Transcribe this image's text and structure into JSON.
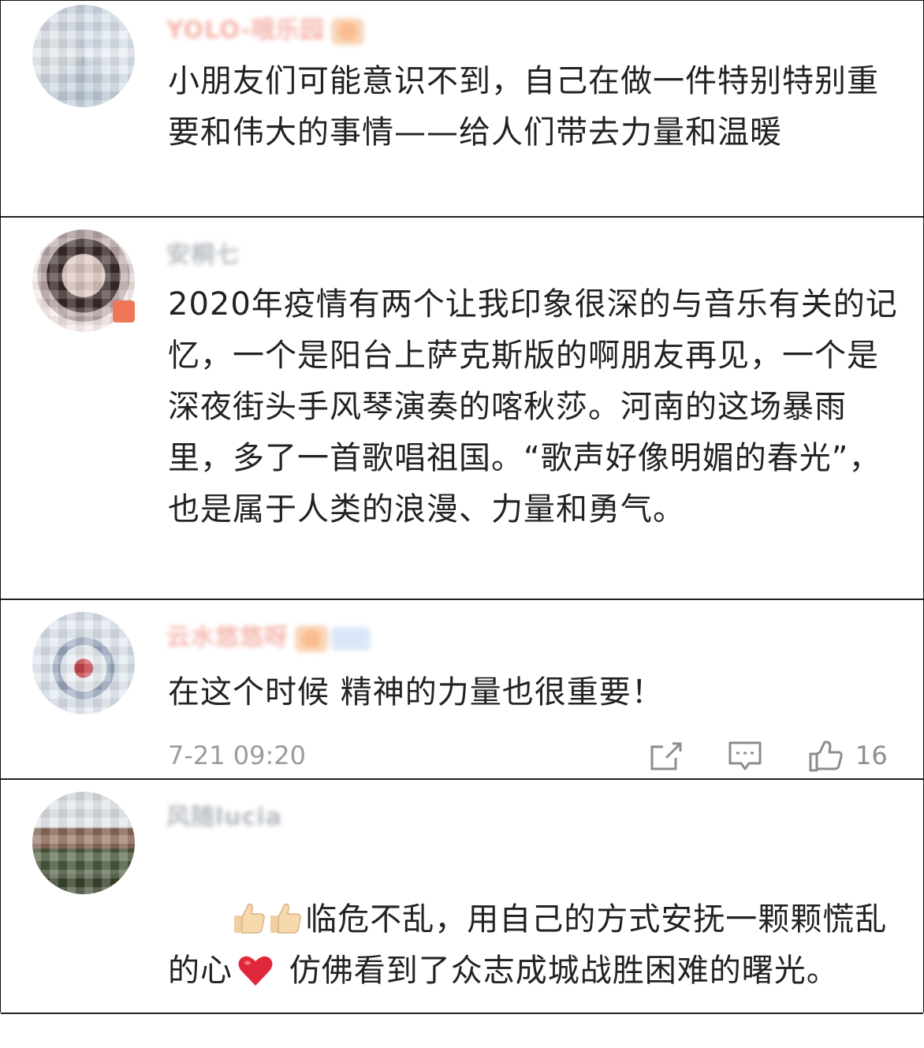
{
  "comments": [
    {
      "username": "YOLO-哦乐园",
      "text": "小朋友们可能意识不到，自己在做一件特别特别重要和伟大的事情——给人们带去力量和温暖"
    },
    {
      "username": "安桐七",
      "text": "2020年疫情有两个让我印象很深的与音乐有关的记忆，一个是阳台上萨克斯版的啊朋友再见，一个是深夜街头手风琴演奏的喀秋莎。河南的这场暴雨里，多了一首歌唱祖国。“歌声好像明媚的春光”，也是属于人类的浪漫、力量和勇气。"
    },
    {
      "username": "云水悠悠呀",
      "text": "在这个时候 精神的力量也很重要！",
      "time": "7-21 09:20",
      "likes": "16"
    },
    {
      "username": "风随lucia",
      "text_part1": "临危不乱，用自己的方式安抚一颗颗慌乱的心",
      "text_part2": " 仿佛看到了众志成城战胜困难的曙光。"
    }
  ],
  "icons": {
    "share": "share-icon",
    "reply": "comment-icon",
    "like": "thumbs-up-icon",
    "emoji_thumb": "thumbs-up-emoji",
    "emoji_heart": "red-heart-emoji"
  },
  "colors": {
    "text": "#222222",
    "meta": "#9b9b9b",
    "username_pink": "#f29b8e",
    "username_gray": "#9da3aa"
  }
}
